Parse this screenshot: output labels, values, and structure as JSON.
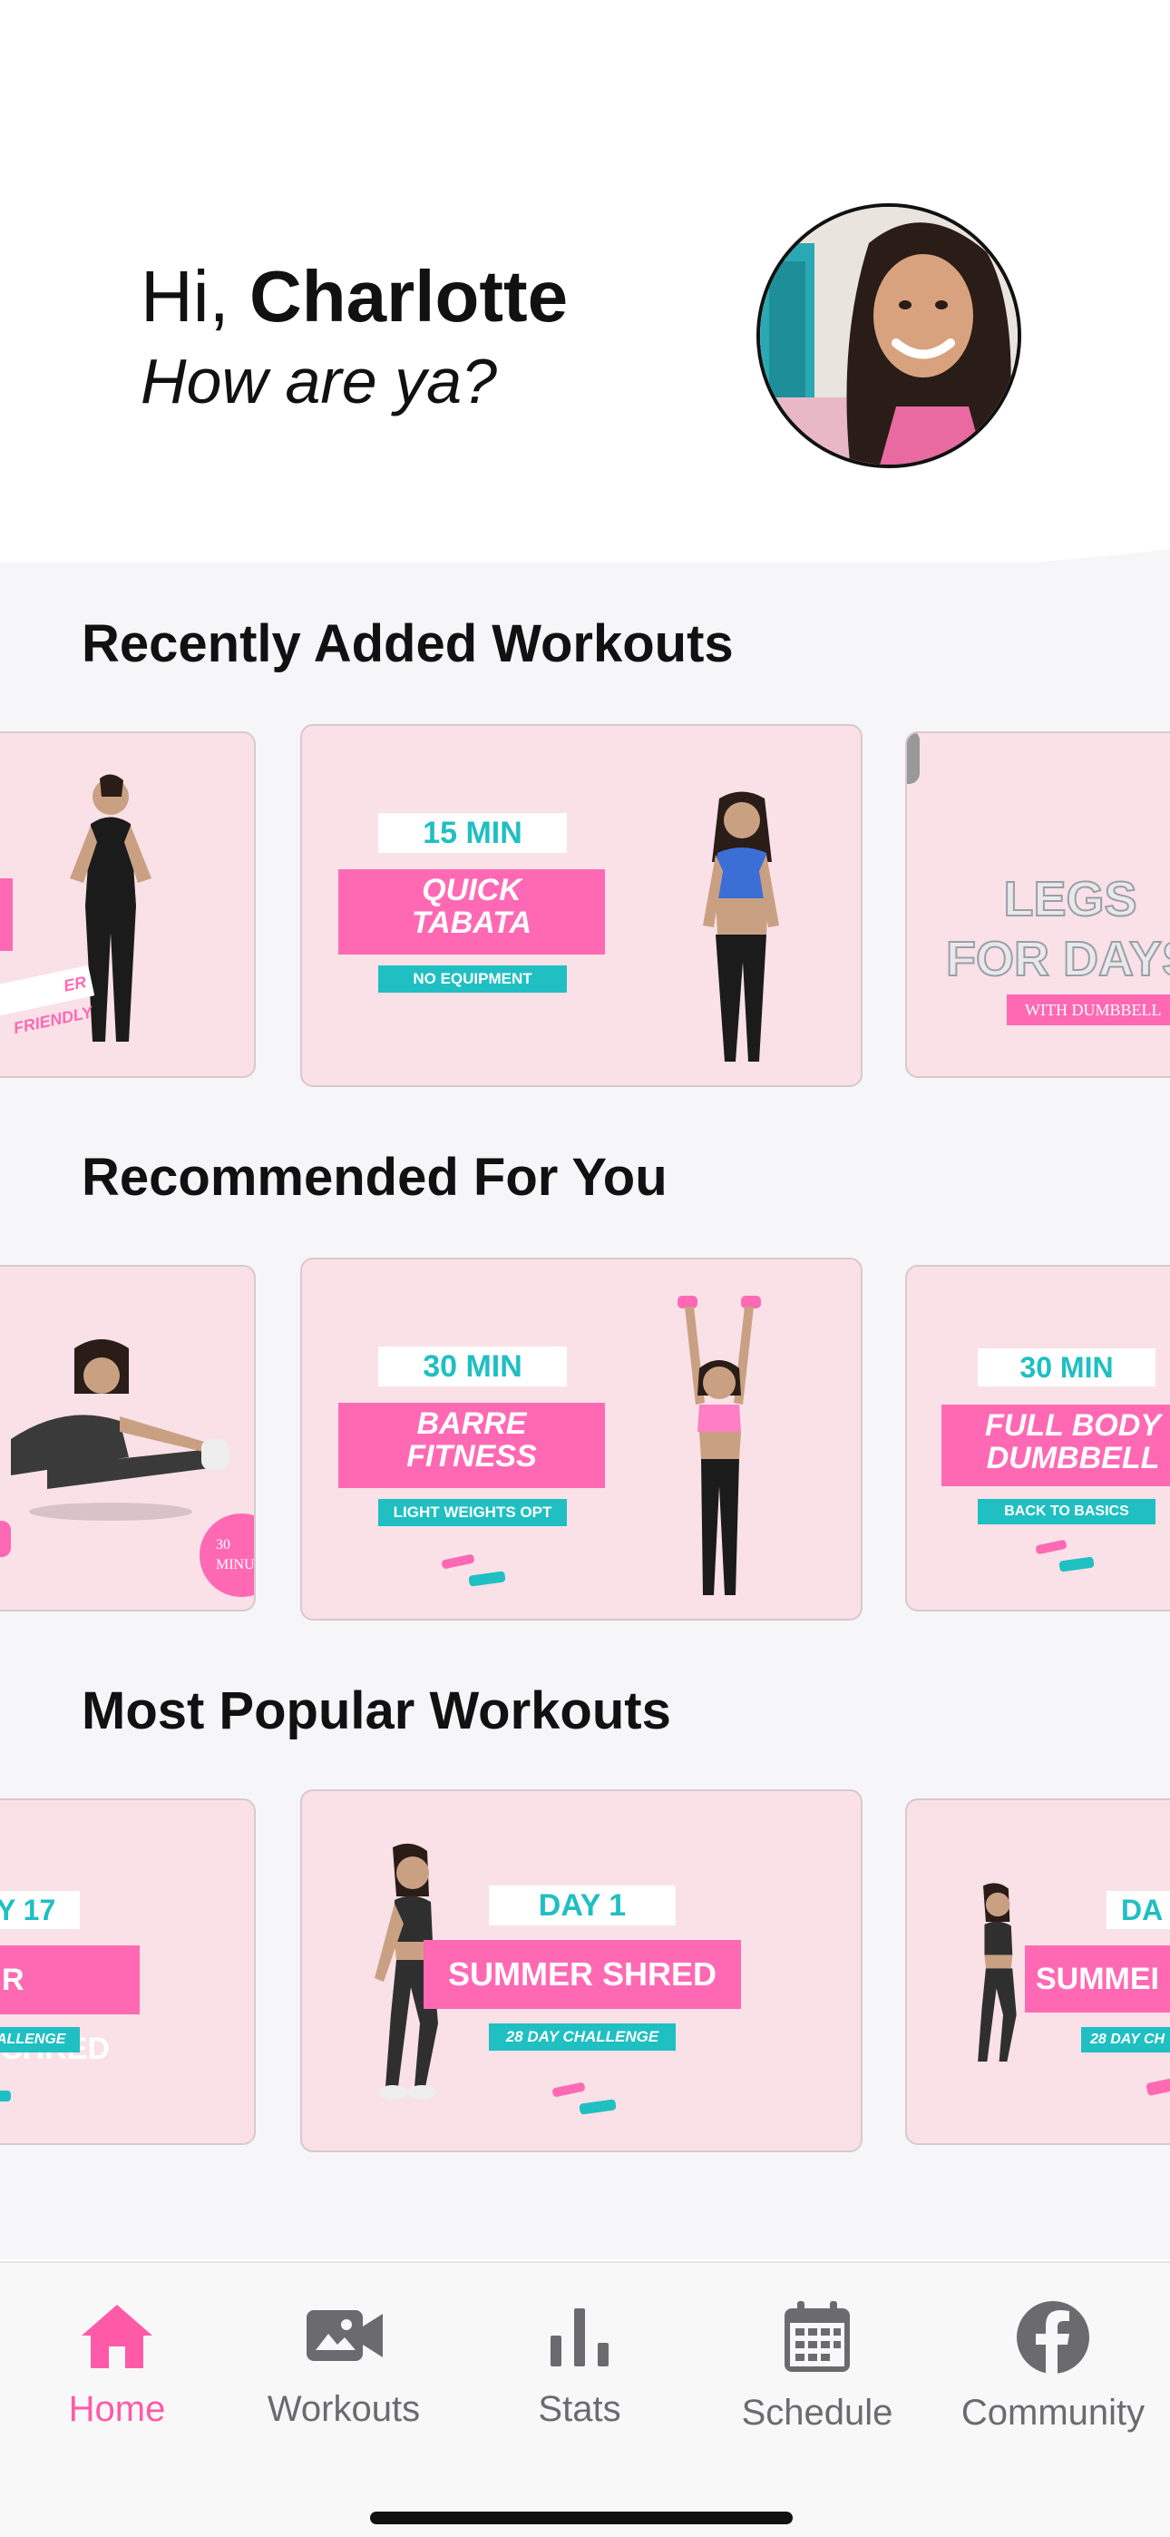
{
  "header": {
    "greeting_prefix": "Hi,",
    "user_name": "Charlotte",
    "subtitle": "How are ya?"
  },
  "sections": {
    "recent": {
      "title": "Recently Added Workouts"
    },
    "recommended": {
      "title": "Recommended For You"
    },
    "popular": {
      "title": "Most Popular Workouts"
    }
  },
  "cards": {
    "recent_left": {
      "caption": "ER FRIENDLY"
    },
    "recent_main": {
      "duration": "15 MIN",
      "name_line1": "QUICK",
      "name_line2": "TABATA",
      "detail": "NO EQUIPMENT"
    },
    "recent_right": {
      "name_line1": "LEGS",
      "name_line2": "FOR DAYS",
      "detail": "WITH DUMBBELL"
    },
    "rec_left": {
      "badge_line1": "30",
      "badge_line2": "MINUT"
    },
    "rec_main": {
      "duration": "30 MIN",
      "name_line1": "BARRE",
      "name_line2": "FITNESS",
      "detail": "LIGHT WEIGHTS OPT"
    },
    "rec_right": {
      "duration": "30 MIN",
      "name_line1": "FULL BODY",
      "name_line2": "DUMBBELL",
      "detail": "BACK TO BASICS"
    },
    "pop_left": {
      "day": "Y 17",
      "name": "R SHRED",
      "detail": "ALLENGE"
    },
    "pop_main": {
      "day": "DAY 1",
      "name": "SUMMER SHRED",
      "detail": "28 DAY CHALLENGE"
    },
    "pop_right": {
      "day": "DA",
      "name": "SUMMEI",
      "detail": "28 DAY CH"
    }
  },
  "tabbar": {
    "items": [
      {
        "label": "Home",
        "icon": "home-icon",
        "active": true
      },
      {
        "label": "Workouts",
        "icon": "video-camera-icon",
        "active": false
      },
      {
        "label": "Stats",
        "icon": "bar-chart-icon",
        "active": false
      },
      {
        "label": "Schedule",
        "icon": "calendar-icon",
        "active": false
      },
      {
        "label": "Community",
        "icon": "facebook-icon",
        "active": false
      }
    ]
  },
  "colors": {
    "accent_pink": "#ff69b4",
    "accent_teal": "#1fbfc2",
    "card_bg": "#f9e1e7",
    "active_tab": "#ff5aa8",
    "inactive_tab": "#6b6b6f"
  }
}
